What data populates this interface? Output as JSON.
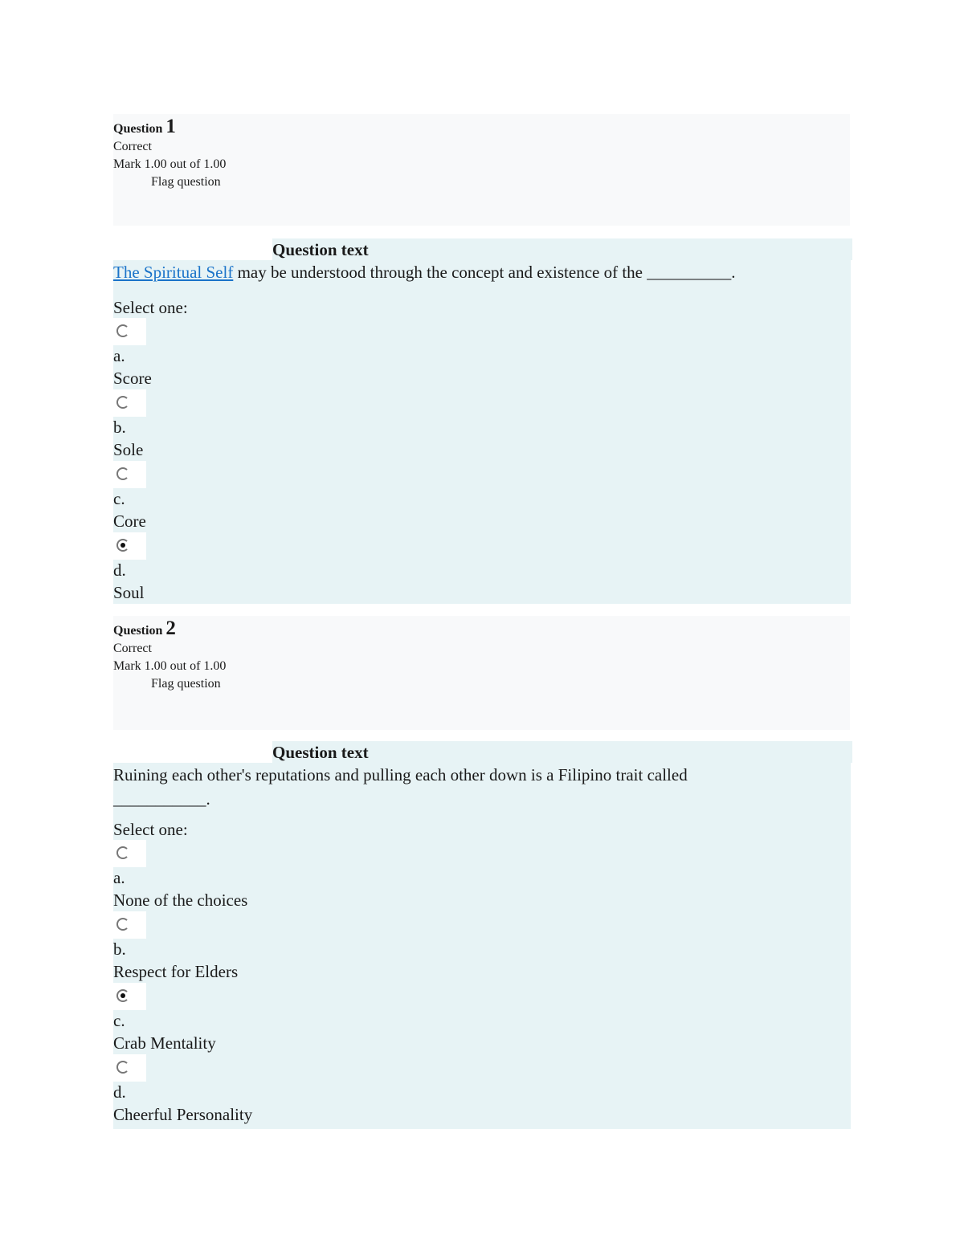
{
  "questions": [
    {
      "label": "Question",
      "number": "1",
      "state": "Correct",
      "mark": "Mark 1.00 out of 1.00",
      "flag": "Flag question",
      "header": "Question text",
      "link": "The Spiritual Self",
      "text": " may be understood through the concept and existence of the ",
      "blank": "__________.",
      "select_label": "Select one:",
      "options": [
        {
          "letter": "a.",
          "text": "Score",
          "checked": false
        },
        {
          "letter": "b.",
          "text": "Sole",
          "checked": false
        },
        {
          "letter": "c.",
          "text": "Core",
          "checked": false
        },
        {
          "letter": "d.",
          "text": "Soul",
          "checked": true
        }
      ]
    },
    {
      "label": "Question",
      "number": "2",
      "state": "Correct",
      "mark": "Mark 1.00 out of 1.00",
      "flag": "Flag question",
      "header": "Question text",
      "text": "Ruining each other's reputations and pulling each other down is a Filipino trait called",
      "blank": "___________.",
      "select_label": "Select one:",
      "options": [
        {
          "letter": "a.",
          "text": "None of the choices",
          "checked": false
        },
        {
          "letter": "b.",
          "text": "Respect for Elders",
          "checked": false
        },
        {
          "letter": "c.",
          "text": "Crab Mentality",
          "checked": true
        },
        {
          "letter": "d.",
          "text": "Cheerful Personality",
          "checked": false
        }
      ]
    }
  ],
  "colors": {
    "info_bg": "#f8f9fa",
    "content_bg": "#e7f3f5",
    "link": "#1a73c9"
  }
}
